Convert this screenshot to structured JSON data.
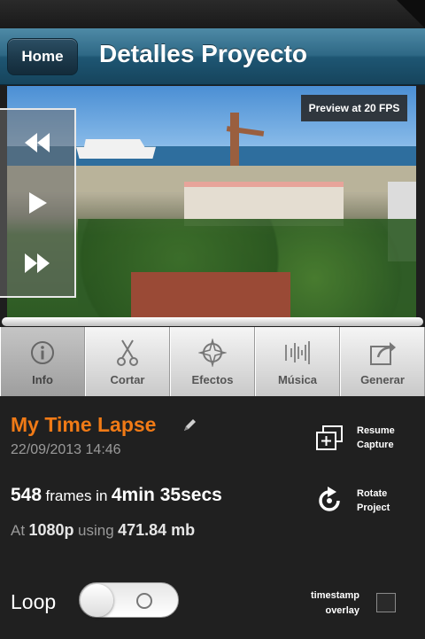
{
  "navbar": {
    "home_label": "Home",
    "title": "Detalles Proyecto"
  },
  "preview": {
    "fps_badge": "Preview at 20 FPS"
  },
  "controls": {
    "rewind_icon": "rewind-icon",
    "play_icon": "play-icon",
    "fast_forward_icon": "fast-forward-icon"
  },
  "tabs": [
    {
      "label": "Info",
      "icon": "info-icon",
      "active": true
    },
    {
      "label": "Cortar",
      "icon": "scissors-icon",
      "active": false
    },
    {
      "label": "Efectos",
      "icon": "effects-icon",
      "active": false
    },
    {
      "label": "Música",
      "icon": "music-icon",
      "active": false
    },
    {
      "label": "Generar",
      "icon": "export-icon",
      "active": false
    }
  ],
  "project": {
    "title": "My Time Lapse",
    "date": "22/09/2013 14:46",
    "frames": "548",
    "frames_in_text": "frames in",
    "duration": "4min 35secs",
    "at_text": "At",
    "resolution": "1080p",
    "using_text": "using",
    "size": "471.84 mb"
  },
  "actions": {
    "resume_line1": "Resume",
    "resume_line2": "Capture",
    "rotate_line1": "Rotate",
    "rotate_line2": "Project"
  },
  "options": {
    "loop_label": "Loop",
    "loop_on": false,
    "timestamp_line1": "timestamp",
    "timestamp_line2": "overlay",
    "timestamp_checked": false
  },
  "colors": {
    "accent_orange": "#f07a16",
    "navbar_blue": "#2e6885",
    "panel_bg": "#202020"
  }
}
